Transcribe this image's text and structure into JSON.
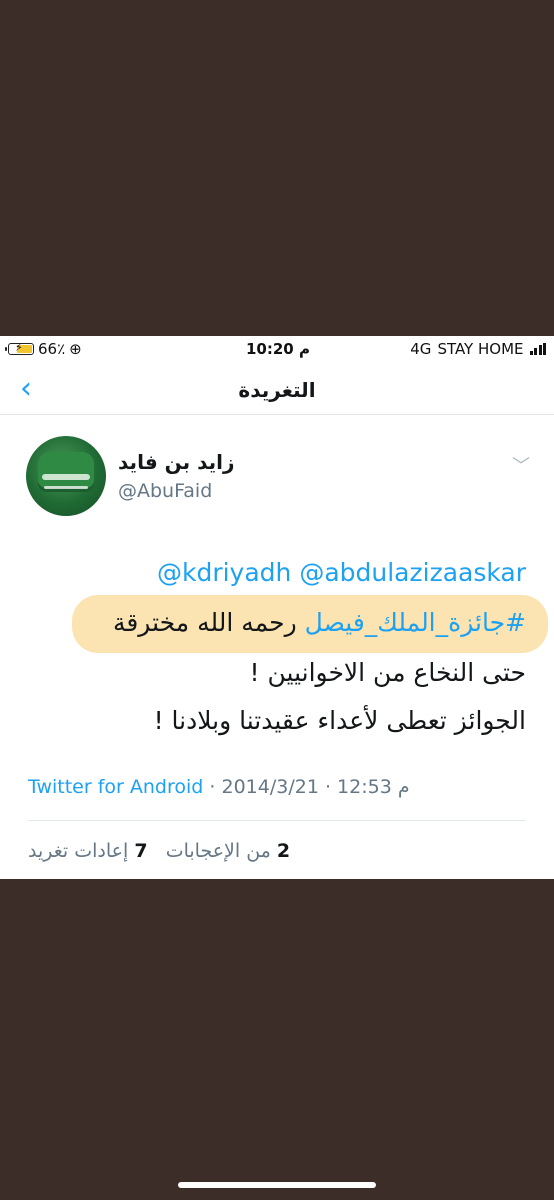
{
  "status_bar": {
    "battery": "66٪",
    "time": "10:20 م",
    "network": "4G",
    "carrier": "STAY HOME"
  },
  "nav": {
    "title": "التغريدة",
    "back_icon": "chevron-left-icon"
  },
  "tweet": {
    "author_name": "زايد بن فايد",
    "author_handle": "@AbuFaid",
    "mentions": "@kdriyadh @abdulazizaaskar",
    "hashtag": "#جائزة_الملك_فيصل",
    "line1_rest": "رحمه الله مخترقة",
    "line2": "حتى النخاع من الاخوانيين !",
    "line3": "الجوائز تعطى لأعداء عقيدتنا وبلادنا !",
    "time": "12:53 م",
    "date": "2014/3/21",
    "source": "Twitter for Android",
    "retweets_count": "2",
    "retweets_label": "من الإعجابات",
    "likes_count": "7",
    "likes_label": "إعادات تغريد"
  },
  "colors": {
    "accent": "#1da1f2",
    "background": "#3d2d29",
    "highlight": "#fbe1a8"
  }
}
